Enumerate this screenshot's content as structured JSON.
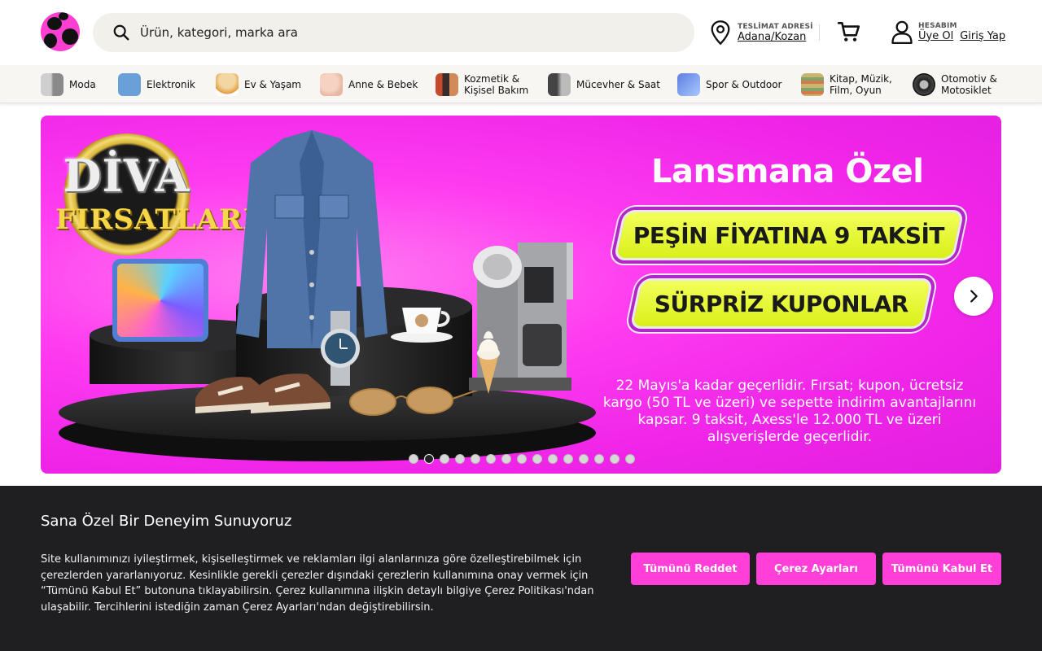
{
  "header": {
    "search": {
      "placeholder": "Ürün, kategori, marka ara"
    },
    "delivery": {
      "caption": "TESLİMAT ADRESİ",
      "value": "Adana/Kozan"
    },
    "account": {
      "caption": "HESABIM",
      "signup": "Üye Ol",
      "login": "Giriş Yap"
    }
  },
  "categories": [
    {
      "label": "Moda",
      "icon": "fashion-icon"
    },
    {
      "label": "Elektronik",
      "icon": "electronics-icon"
    },
    {
      "label": "Ev & Yaşam",
      "icon": "home-lamp-icon"
    },
    {
      "label": "Anne & Bebek",
      "icon": "baby-icon"
    },
    {
      "label": "Kozmetik &\nKişisel Bakım",
      "icon": "cosmetics-icon"
    },
    {
      "label": "Mücevher & Saat",
      "icon": "jewelry-icon"
    },
    {
      "label": "Spor & Outdoor",
      "icon": "sport-icon"
    },
    {
      "label": "Kitap, Müzik,\nFilm, Oyun",
      "icon": "books-icon"
    },
    {
      "label": "Otomotiv &\nMotosiklet",
      "icon": "tire-icon"
    }
  ],
  "banner": {
    "badge_line1": "DİVA",
    "badge_line2": "FIRSATLARI",
    "title": "Lansmana Özel",
    "pill1": "PEŞİN FİYATINA 9 TAKSİT",
    "pill2": "SÜRPRİZ KUPONLAR",
    "note": "22 Mayıs'a kadar geçerlidir. Fırsat; kupon, ücretsiz kargo (50 TL ve üzeri) ve sepette indirim avantajlarını kapsar. 9 taksit, Axess'le 12.000 TL ve üzeri alışverişlerde geçerlidir.",
    "slide_count": 15,
    "active_slide": 2
  },
  "cookie": {
    "title": "Sana Özel Bir Deneyim Sunuyoruz",
    "text": "Site kullanımınızı iyileştirmek, kişiselleştirmek ve reklamları ilgi alanlarınıza göre özelleştirebilmek için çerezlerden yararlanıyoruz. Kesinlikle gerekli çerezler dışındaki çerezlerin kullanımına onay vermek için “Tümünü Kabul Et” butonuna tıklayabilirsin. Çerez kullanımına ilişkin detaylı bilgiye Çerez Politikası'ndan ulaşabilir. Tercihlerini istediğin zaman Çerez Ayarları'ndan değiştirebilirsin.",
    "reject": "Tümünü Reddet",
    "settings": "Çerez Ayarları",
    "accept": "Tümünü Kabul Et"
  },
  "colors": {
    "brand": "#ff3fd8",
    "dark": "#1f1f21",
    "search_bg": "#f1f0eb"
  }
}
